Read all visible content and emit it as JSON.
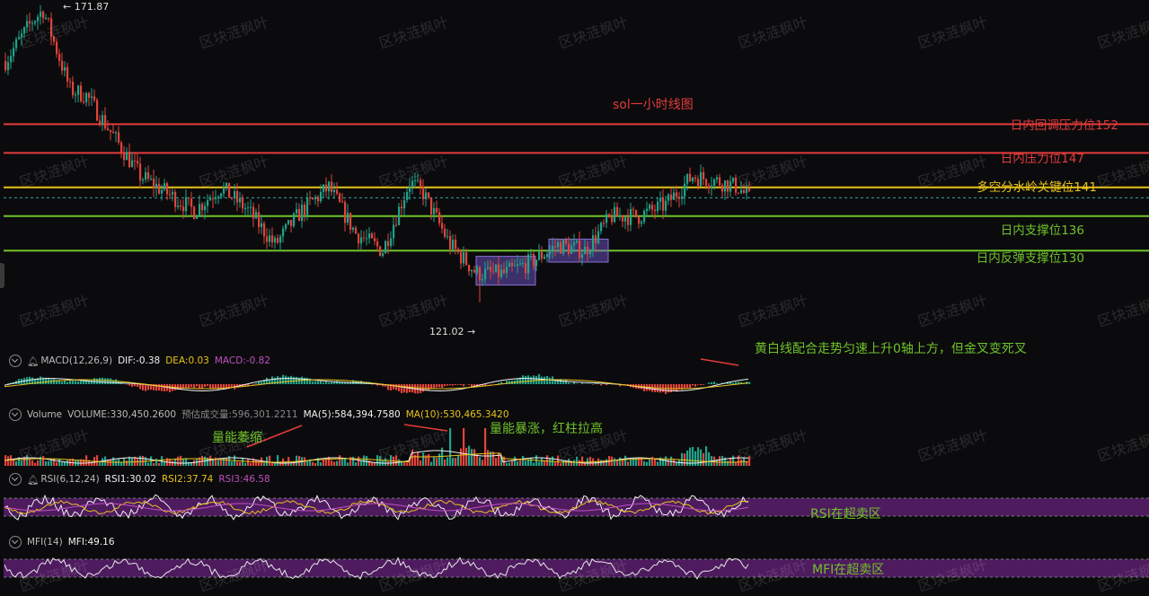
{
  "chart_title": "sol一小时线图",
  "price_pane": {
    "high_label": "← 171.87",
    "low_label": "121.02 →",
    "levels": [
      {
        "label": "日内回调压力位152",
        "value": 152,
        "color": "#e23b3b"
      },
      {
        "label": "日内压力位147",
        "value": 147,
        "color": "#e23b3b"
      },
      {
        "label": "多空分水岭关键位141",
        "value": 141,
        "color": "#e8c21a"
      },
      {
        "label": "日内支撑位136",
        "value": 136,
        "color": "#6fc22a"
      },
      {
        "label": "日内反弹支撑位130",
        "value": 130,
        "color": "#6fc22a"
      }
    ]
  },
  "macd_pane": {
    "label": "MACD(12,26,9)",
    "dif": "DIF:-0.38",
    "dea": "DEA:0.03",
    "macd": "MACD:-0.82",
    "annotation": "黄白线配合走势匀速上升0轴上方，但金叉变死叉"
  },
  "volume_pane": {
    "label": "Volume",
    "volume": "VOLUME:330,450.2600",
    "est": "预估成交量:596,301.2211",
    "ma5": "MA(5):584,394.7580",
    "ma10": "MA(10):530,465.3420",
    "annotation_left": "量能萎缩",
    "annotation_right": "量能暴涨，红柱拉高"
  },
  "rsi_pane": {
    "label": "RSI(6,12,24)",
    "rsi1": "RSI1:30.02",
    "rsi2": "RSI2:37.74",
    "rsi3": "RSI3:46.58",
    "annotation": "RSI在超卖区"
  },
  "mfi_pane": {
    "label": "MFI(14)",
    "mfi": "MFI:49.16",
    "annotation": "MFI在超卖区"
  },
  "watermark": "区块涟枫叶",
  "colors": {
    "up": "#1fa38a",
    "down": "#e2433a",
    "resistance": "#e23b3b",
    "pivot": "#e8c21a",
    "support": "#6fc22a",
    "box": "#8a6fd6",
    "band": "#5a1e6e"
  },
  "chart_data": {
    "type": "candlestick",
    "title": "sol一小时线图",
    "price_range": [
      121.02,
      171.87
    ],
    "visible_price_axis_approx": [
      117,
      173
    ],
    "path_keypoints": [
      {
        "bar": 0,
        "price": 163
      },
      {
        "bar": 10,
        "price": 170
      },
      {
        "bar": 14,
        "price": 171.87
      },
      {
        "bar": 24,
        "price": 158
      },
      {
        "bar": 30,
        "price": 157
      },
      {
        "bar": 40,
        "price": 150
      },
      {
        "bar": 50,
        "price": 143
      },
      {
        "bar": 60,
        "price": 140
      },
      {
        "bar": 70,
        "price": 137
      },
      {
        "bar": 80,
        "price": 141
      },
      {
        "bar": 90,
        "price": 137
      },
      {
        "bar": 100,
        "price": 131
      },
      {
        "bar": 110,
        "price": 137
      },
      {
        "bar": 120,
        "price": 141
      },
      {
        "bar": 130,
        "price": 133
      },
      {
        "bar": 140,
        "price": 130
      },
      {
        "bar": 150,
        "price": 142
      },
      {
        "bar": 155,
        "price": 140
      },
      {
        "bar": 165,
        "price": 131
      },
      {
        "bar": 175,
        "price": 126
      },
      {
        "bar": 185,
        "price": 126
      },
      {
        "bar": 195,
        "price": 128
      },
      {
        "bar": 205,
        "price": 131
      },
      {
        "bar": 215,
        "price": 130
      },
      {
        "bar": 225,
        "price": 136
      },
      {
        "bar": 235,
        "price": 136
      },
      {
        "bar": 245,
        "price": 138
      },
      {
        "bar": 255,
        "price": 143
      },
      {
        "bar": 265,
        "price": 142
      },
      {
        "bar": 272,
        "price": 141
      },
      {
        "bar": 276,
        "price": 139
      }
    ],
    "consolidation_boxes": [
      {
        "from_bar": 175,
        "to_bar": 197,
        "low": 124,
        "high": 129
      },
      {
        "from_bar": 202,
        "to_bar": 224,
        "low": 128,
        "high": 132
      }
    ],
    "levels": [
      152,
      147,
      141,
      136,
      130
    ]
  }
}
